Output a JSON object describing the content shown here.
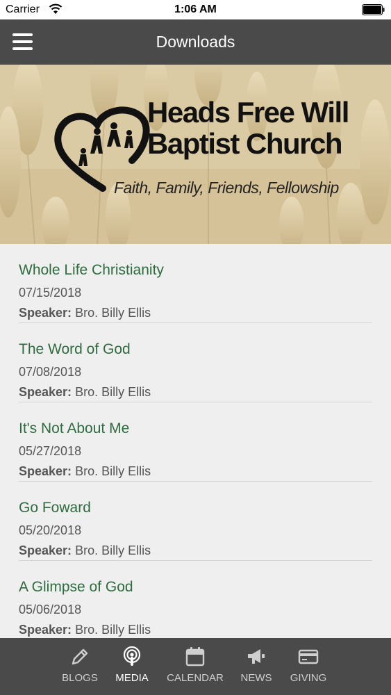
{
  "status_bar": {
    "carrier": "Carrier",
    "time": "1:06 AM"
  },
  "header": {
    "title": "Downloads",
    "menu_icon": "hamburger-menu-icon"
  },
  "banner": {
    "church_name_line1": "Heads Free Will",
    "church_name_line2": "Baptist Church",
    "tagline": "Faith, Family, Friends, Fellowship",
    "logo_icon": "heart-family-logo"
  },
  "sermons": [
    {
      "title": "Whole Life Christianity",
      "date": "07/15/2018",
      "speaker_label": "Speaker:",
      "speaker": "Bro. Billy Ellis"
    },
    {
      "title": "The Word of God",
      "date": "07/08/2018",
      "speaker_label": "Speaker:",
      "speaker": "Bro. Billy Ellis"
    },
    {
      "title": "It's Not About Me",
      "date": "05/27/2018",
      "speaker_label": "Speaker:",
      "speaker": "Bro. Billy Ellis"
    },
    {
      "title": "Go Foward",
      "date": "05/20/2018",
      "speaker_label": "Speaker:",
      "speaker": "Bro. Billy Ellis"
    },
    {
      "title": "A Glimpse of God",
      "date": "05/06/2018",
      "speaker_label": "Speaker:",
      "speaker": "Bro. Billy Ellis"
    }
  ],
  "tabs": [
    {
      "label": "BLOGS",
      "icon": "pencil-icon",
      "active": false
    },
    {
      "label": "MEDIA",
      "icon": "podcast-icon",
      "active": true
    },
    {
      "label": "CALENDAR",
      "icon": "calendar-icon",
      "active": false
    },
    {
      "label": "NEWS",
      "icon": "megaphone-icon",
      "active": false
    },
    {
      "label": "GIVING",
      "icon": "credit-card-icon",
      "active": false
    }
  ],
  "colors": {
    "nav_bg": "#4a4a4a",
    "title_green": "#2e6b3f",
    "list_bg": "#efefef",
    "tab_inactive": "#cfcfcf"
  }
}
